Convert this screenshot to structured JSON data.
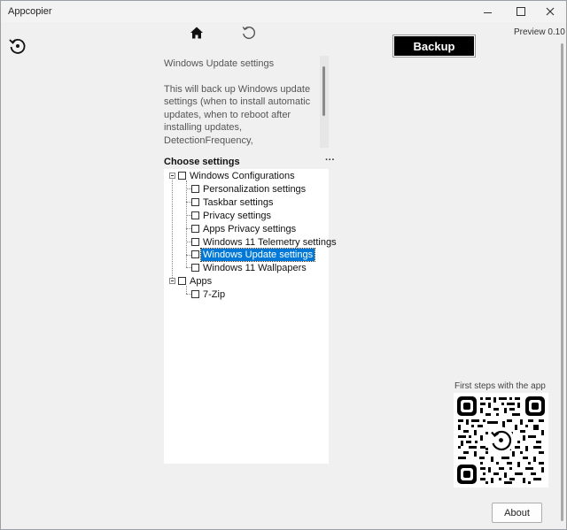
{
  "window": {
    "title": "Appcopier",
    "minimize_icon": "minimize-icon",
    "maximize_icon": "maximize-icon",
    "close_icon": "close-icon"
  },
  "toolbar": {
    "home_icon": "home-icon",
    "refresh_icon": "refresh-icon",
    "side_icon": "restore-icon"
  },
  "backup_label": "Backup",
  "version": "Preview 0.10",
  "description": {
    "title": "Windows Update settings",
    "body": "This will back up Windows update settings (when to install automatic updates, when to reboot after installing updates, DetectionFrequency, TargetReleaseVersion, etc.)"
  },
  "choose_label": "Choose settings",
  "more_icon": "more-icon",
  "tree": {
    "root1": {
      "label": "Windows Configurations",
      "children": [
        "Personalization settings",
        "Taskbar settings",
        "Privacy settings",
        "Apps Privacy settings",
        "Windows 11 Telemetry settings",
        "Windows Update settings",
        "Windows 11 Wallpapers"
      ],
      "selected_index": 5
    },
    "root2": {
      "label": "Apps",
      "children": [
        "7-Zip"
      ]
    }
  },
  "first_steps": "First steps with the app",
  "about_label": "About",
  "colors": {
    "selection": "#0078d7",
    "backup_bg": "#000000",
    "window_bg": "#f0f0f0"
  }
}
